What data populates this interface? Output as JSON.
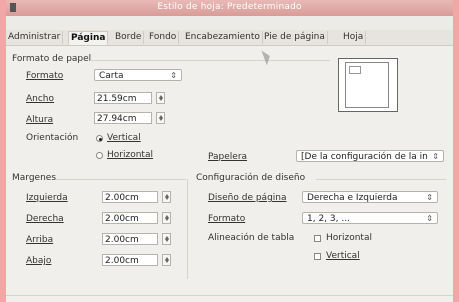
{
  "window": {
    "title": "Estilo de hoja: Predeterminado"
  },
  "tabs": [
    {
      "label": "Administrar",
      "active": false
    },
    {
      "label": "Página",
      "active": true
    },
    {
      "label": "Borde",
      "active": false
    },
    {
      "label": "Fondo",
      "active": false
    },
    {
      "label": "Encabezamiento",
      "active": false
    },
    {
      "label": "Pie de página",
      "active": false
    },
    {
      "label": "Hoja",
      "active": false
    }
  ],
  "paper": {
    "section_title": "Formato de papel",
    "format_label": "Formato",
    "format_value": "Carta",
    "width_label": "Ancho",
    "width_value": "21.59cm",
    "height_label": "Altura",
    "height_value": "27.94cm",
    "orientation_label": "Orientación",
    "vertical_label": "Vertical",
    "horizontal_label": "Horizontal",
    "orientation_selected": "vertical",
    "tray_label": "Papelera",
    "tray_value": "[De la configuración de la in"
  },
  "margins": {
    "section_title": "Margenes",
    "left_label": "Izquierda",
    "left_value": "2.00cm",
    "right_label": "Derecha",
    "right_value": "2.00cm",
    "top_label": "Arriba",
    "top_value": "2.00cm",
    "bottom_label": "Abajo",
    "bottom_value": "2.00cm"
  },
  "layout": {
    "section_title": "Configuración de diseño",
    "page_layout_label": "Diseño de página",
    "page_layout_value": "Derecha e Izquierda",
    "format_label": "Formato",
    "format_value": "1, 2, 3, ...",
    "table_align_label": "Alineación de tabla",
    "horizontal_label": "Horizontal",
    "vertical_label": "Vertical"
  },
  "colors": {
    "background": "#f2a7a7",
    "dialog_bg": "#ecebe8",
    "titlebar": "#d99c98"
  },
  "icons": [
    "window-icon",
    "combo-arrow-icon",
    "spin-up-icon",
    "spin-down-icon",
    "radio-icon",
    "checkbox-icon",
    "page-preview-icon",
    "mouse-cursor-icon"
  ]
}
